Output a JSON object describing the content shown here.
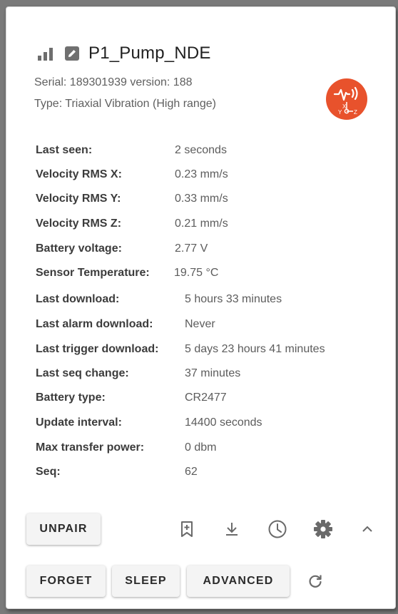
{
  "device": {
    "name": "P1_Pump_NDE",
    "serial_line": "Serial: 189301939 version: 188",
    "type_line": "Type: Triaxial Vibration (High range)",
    "badge_color": "#e8522c",
    "badge_icon": "triaxial-vibration-sensor-icon",
    "badge_axis_x": "X",
    "badge_axis_y": "Y",
    "badge_axis_z": "Z"
  },
  "info": [
    {
      "label": "Last seen:",
      "value": "2 seconds"
    },
    {
      "label": "Velocity RMS X:",
      "value": "0.23 mm/s"
    },
    {
      "label": "Velocity RMS Y:",
      "value": "0.33 mm/s"
    },
    {
      "label": "Velocity RMS Z:",
      "value": "0.21 mm/s"
    },
    {
      "label": "Battery voltage:",
      "value": "2.77 V"
    },
    {
      "label": "Sensor Temperature:",
      "value": "19.75 °C"
    },
    {
      "label": "Last download:",
      "value": "5 hours 33 minutes"
    },
    {
      "label": "Last alarm download:",
      "value": "Never"
    },
    {
      "label": "Last trigger download:",
      "value": "5 days 23 hours 41 minutes"
    },
    {
      "label": "Last seq change:",
      "value": "37 minutes"
    },
    {
      "label": "Battery type:",
      "value": "CR2477"
    },
    {
      "label": "Update interval:",
      "value": "14400 seconds"
    },
    {
      "label": "Max transfer power:",
      "value": "0 dbm"
    },
    {
      "label": "Seq:",
      "value": "62"
    }
  ],
  "actions": {
    "unpair": "UNPAIR",
    "forget": "FORGET",
    "sleep": "SLEEP",
    "advanced": "ADVANCED"
  },
  "icons": {
    "signal": "signal-strength-icon",
    "edit": "edit-icon",
    "bookmark": "bookmark-add-icon",
    "download": "download-icon",
    "history": "clock-icon",
    "settings": "gear-icon",
    "collapse": "chevron-up-icon",
    "refresh": "refresh-icon"
  },
  "colors": {
    "icon": "#6a6a6a",
    "accent": "#e8522c"
  }
}
